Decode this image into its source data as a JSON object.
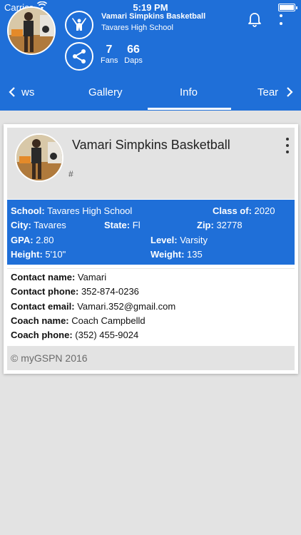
{
  "status_bar": {
    "carrier": "Carrier",
    "time": "5:19 PM"
  },
  "header": {
    "team_name": "Vamari Simpkins Basketball",
    "school": "Tavares High School",
    "fans_count": "7",
    "fans_label": "Fans",
    "daps_count": "66",
    "daps_label": "Daps"
  },
  "tabs": [
    {
      "label": "ws"
    },
    {
      "label": "Gallery"
    },
    {
      "label": "Info",
      "active": true
    },
    {
      "label": "Tear"
    }
  ],
  "card": {
    "title": "Vamari Simpkins Basketball",
    "hash": "#"
  },
  "details": {
    "school_label": "School:",
    "school": "Tavares High School",
    "class_label": "Class of:",
    "class": "2020",
    "city_label": "City:",
    "city": "Tavares",
    "state_label": "State:",
    "state": "Fl",
    "zip_label": "Zip:",
    "zip": "32778",
    "gpa_label": "GPA:",
    "gpa": "2.80",
    "level_label": "Level:",
    "level": "Varsity",
    "height_label": "Height:",
    "height": "5'10\"",
    "weight_label": "Weight:",
    "weight": "135"
  },
  "contact": {
    "name_label": "Contact name:",
    "name": "Vamari",
    "phone_label": "Contact phone:",
    "phone": "352-874-0236",
    "email_label": "Contact email:",
    "email": "Vamari.352@gmail.com",
    "coach_label": "Coach name:",
    "coach": "Coach Campbelld",
    "coach_phone_label": "Coach phone:",
    "coach_phone": "(352) 455-9024"
  },
  "footer": {
    "copyright": "© myGSPN 2016"
  },
  "colors": {
    "brand_blue": "#1f6fd8",
    "background": "#e3e3e3"
  },
  "icons": [
    "wifi-icon",
    "battery-icon",
    "cheer-icon",
    "share-icon",
    "bell-icon",
    "more-vertical-icon",
    "chevron-left-icon",
    "chevron-right-icon"
  ]
}
